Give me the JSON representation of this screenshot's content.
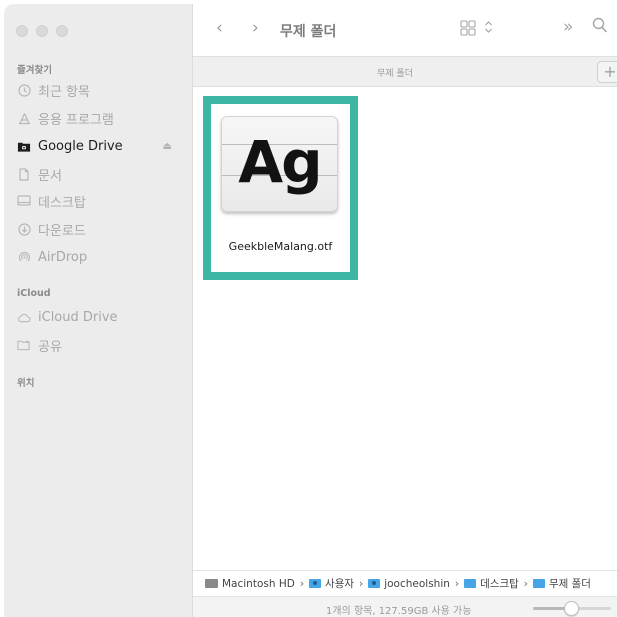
{
  "sidebar": {
    "favorites_header": "즐겨찾기",
    "favorites": [
      {
        "label": "최근 항목",
        "icon": "clock-icon"
      },
      {
        "label": "응용 프로그램",
        "icon": "applications-icon"
      },
      {
        "label": "Google Drive",
        "icon": "drive-icon",
        "active": true
      },
      {
        "label": "문서",
        "icon": "document-icon"
      },
      {
        "label": "데스크탑",
        "icon": "desktop-icon"
      },
      {
        "label": "다운로드",
        "icon": "download-icon"
      },
      {
        "label": "AirDrop",
        "icon": "airdrop-icon"
      }
    ],
    "icloud_header": "iCloud",
    "icloud": [
      {
        "label": "iCloud Drive",
        "icon": "cloud-icon"
      },
      {
        "label": "공유",
        "icon": "shared-folder-icon"
      }
    ],
    "locations_header": "위치"
  },
  "toolbar": {
    "back_icon": "‹",
    "forward_icon": "›",
    "title": "무제 폴더",
    "more_icon": "»",
    "search_icon": "⌕"
  },
  "tabbar": {
    "title": "무제 폴더",
    "add_label": "+"
  },
  "file": {
    "name": "GeekbleMalang.otf",
    "preview_text": "Ag"
  },
  "pathbar": [
    "Macintosh HD",
    "사용자",
    "joocheolshin",
    "데스크탑",
    "무제 폴더"
  ],
  "status": {
    "text": "1개의 항목, 127.59GB 사용 가능",
    "zoom_fraction": 0.5
  },
  "colors": {
    "selection": "#3eb6a6",
    "folder": "#45a5e6"
  }
}
